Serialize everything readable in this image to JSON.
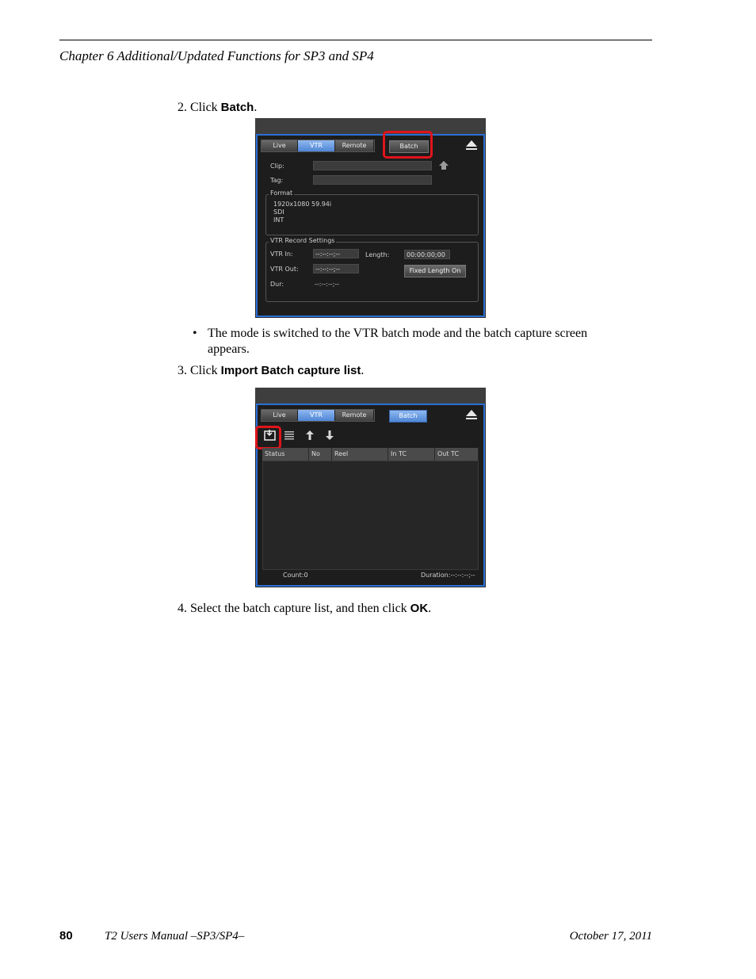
{
  "header": {
    "chapter_title": "Chapter 6   Additional/Updated Functions for SP3 and SP4"
  },
  "steps": {
    "step2_prefix": "2. Click ",
    "step2_bold": "Batch",
    "step2_suffix": ".",
    "bullet": "The mode is switched to the VTR batch mode and the batch capture screen appears.",
    "step3_prefix": "3. Click ",
    "step3_bold": "Import Batch capture list",
    "step3_suffix": ".",
    "step4_prefix": "4. Select the batch capture list, and then click ",
    "step4_bold": "OK",
    "step4_suffix": "."
  },
  "shot1": {
    "tabs": [
      "Live",
      "VTR",
      "Remote"
    ],
    "active_tab": "VTR",
    "batch_label": "Batch",
    "clip_label": "Clip:",
    "tag_label": "Tag:",
    "format_title": "Format",
    "format_lines": [
      "1920x1080 59.94i",
      "SDI",
      "INT"
    ],
    "vtr_title": "VTR Record Settings",
    "vtr_in_label": "VTR In:",
    "vtr_in_value": "--:--:--;--",
    "vtr_out_label": "VTR Out:",
    "vtr_out_value": "--:--:--;--",
    "dur_label": "Dur:",
    "dur_value": "--:--:--;--",
    "length_label": "Length:",
    "length_value": "00:00:00;00",
    "fixed_length_label": "Fixed Length On"
  },
  "shot2": {
    "tabs": [
      "Live",
      "VTR",
      "Remote"
    ],
    "active_tab": "VTR",
    "batch_label": "Batch",
    "columns": [
      "Status",
      "No",
      "Reel",
      "In TC",
      "Out TC"
    ],
    "count_text": "Count:0",
    "duration_text": "Duration:--:--:--;--"
  },
  "icons": [
    "import-icon",
    "list-icon",
    "arrow-up-icon",
    "arrow-down-icon",
    "eject-icon",
    "upload-icon"
  ],
  "colors": {
    "highlight_ring": "#e0141b",
    "frame_blue": "#2b6fd6",
    "active_tab": "#4f86d6"
  },
  "footer": {
    "page_number": "80",
    "manual_title": "T2 Users Manual –SP3/SP4–",
    "date": "October 17, 2011"
  }
}
